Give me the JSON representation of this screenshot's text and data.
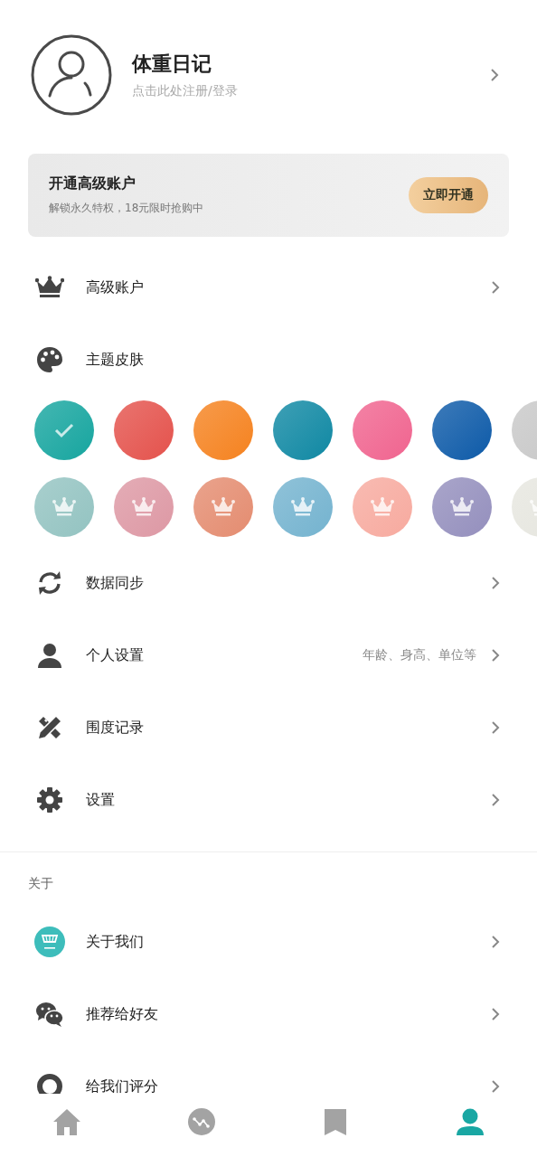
{
  "profile": {
    "title": "体重日记",
    "subtitle": "点击此处注册/登录"
  },
  "promo": {
    "title": "开通高级账户",
    "subtitle": "解锁永久特权，18元限时抢购中",
    "button": "立即开通"
  },
  "menu_top": [
    {
      "label": "高级账户",
      "arrow": true
    },
    {
      "label": "主题皮肤",
      "arrow": false
    }
  ],
  "themes": [
    [
      {
        "color": "#16a59f",
        "selected": true,
        "locked": false
      },
      {
        "color": "#e4524c",
        "selected": false,
        "locked": false
      },
      {
        "color": "#f5821f",
        "selected": false,
        "locked": false
      },
      {
        "color": "#0f88a3",
        "selected": false,
        "locked": false
      },
      {
        "color": "#f0648f",
        "selected": false,
        "locked": false
      },
      {
        "color": "#0d5aa8",
        "selected": false,
        "locked": false
      },
      {
        "color": "#c8c8c8",
        "selected": false,
        "locked": false
      }
    ],
    [
      {
        "color": "#93c3c1",
        "selected": false,
        "locked": true
      },
      {
        "color": "#dd98a4",
        "selected": false,
        "locked": true
      },
      {
        "color": "#e48c70",
        "selected": false,
        "locked": true
      },
      {
        "color": "#74b3cf",
        "selected": false,
        "locked": true
      },
      {
        "color": "#f7aa9f",
        "selected": false,
        "locked": true
      },
      {
        "color": "#948fbd",
        "selected": false,
        "locked": true
      },
      {
        "color": "#e6e6df",
        "selected": false,
        "locked": true
      }
    ]
  ],
  "menu_main": [
    {
      "label": "数据同步",
      "arrow": true
    },
    {
      "label": "个人设置",
      "detail": "年龄、身高、单位等",
      "arrow": true
    },
    {
      "label": "围度记录",
      "arrow": true
    },
    {
      "label": "设置",
      "arrow": true
    }
  ],
  "about": {
    "heading": "关于",
    "items": [
      {
        "label": "关于我们",
        "arrow": true
      },
      {
        "label": "推荐给好友",
        "arrow": true
      },
      {
        "label": "给我们评分",
        "arrow": true
      }
    ]
  },
  "tab_bar": [
    {
      "selected": false
    },
    {
      "selected": false
    },
    {
      "selected": false
    },
    {
      "selected": true
    }
  ]
}
